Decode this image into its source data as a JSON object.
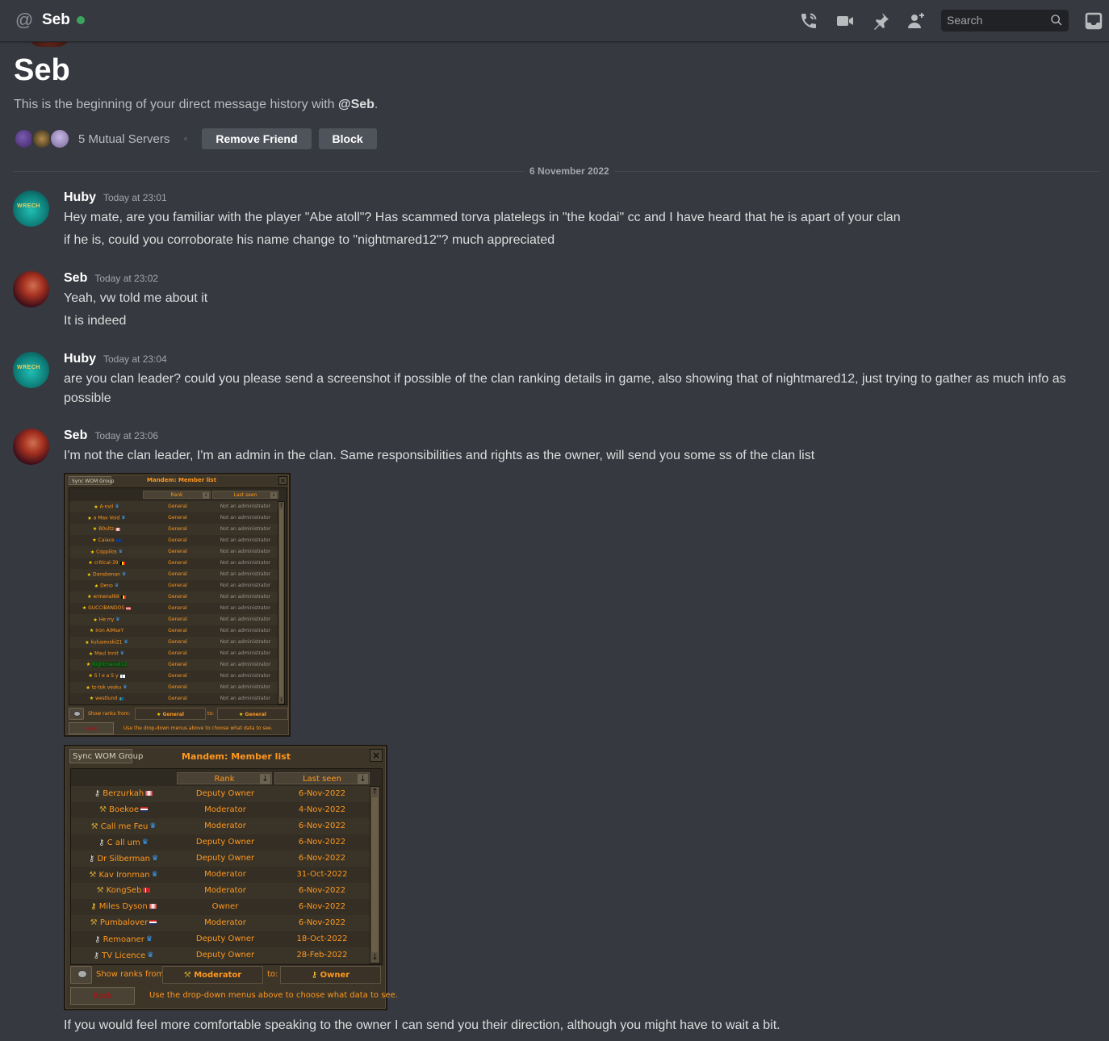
{
  "header": {
    "channel_name": "Seb",
    "status": "online",
    "status_color": "#3ba55d",
    "icons": [
      "start-voice-call-icon",
      "start-video-call-icon",
      "pinned-messages-icon",
      "add-friends-to-dm-icon"
    ],
    "search_placeholder": "Search",
    "inbox_icon": "inbox-icon"
  },
  "intro": {
    "name": "Seb",
    "subtitle_prefix": "This is the beginning of your direct message history with ",
    "subtitle_mention": "@Seb",
    "subtitle_suffix": ".",
    "mutual_servers": "5 Mutual Servers",
    "remove_friend": "Remove Friend",
    "block": "Block"
  },
  "date_divider": "6 November 2022",
  "messages": [
    {
      "author": "Huby",
      "time": "Today at 23:01",
      "lines": [
        "Hey mate, are you familiar with the player \"Abe atoll\"? Has scammed torva platelegs in \"the kodai\" cc and I have heard that he is apart of your clan",
        "if he is, could you corroborate his name change to \"nightmared12\"? much appreciated"
      ]
    },
    {
      "author": "Seb",
      "time": "Today at 23:02",
      "lines": [
        "Yeah, vw told me about it",
        "It is indeed"
      ]
    },
    {
      "author": "Huby",
      "time": "Today at 23:04",
      "lines": [
        "are you clan leader? could you please send a screenshot if possible of the clan ranking details in game, also showing that of nightmared12, just trying to gather as much info as possible"
      ]
    },
    {
      "author": "Seb",
      "time": "Today at 23:06",
      "lines": [
        "I'm not the clan leader, I'm an admin in the clan. Same responsibilities and rights as the owner, will send you some ss of the clan list",
        "If you would feel more comfortable speaking to the owner I can send you their direction, although you might have to wait a bit."
      ]
    }
  ],
  "attachments": [
    {
      "sync_button": "Sync WOM Group",
      "title": "Mandem: Member list",
      "col_rank": "Rank",
      "col_last_seen": "Last seen",
      "rows": [
        {
          "icon": "star",
          "name": "A-nvil",
          "flag": "crown",
          "rank": "General",
          "seen": "Not an administrator"
        },
        {
          "icon": "star",
          "name": "a Max Void",
          "flag": "crown",
          "rank": "General",
          "seen": "Not an administrator"
        },
        {
          "icon": "star",
          "name": "B0ultz",
          "flag": "uk",
          "rank": "General",
          "seen": "Not an administrator"
        },
        {
          "icon": "star",
          "name": "Caiace",
          "flag": "au",
          "rank": "General",
          "seen": "Not an administrator"
        },
        {
          "icon": "star",
          "name": "Coppilos",
          "flag": "crown",
          "rank": "General",
          "seen": "Not an administrator"
        },
        {
          "icon": "star",
          "name": "critical-39",
          "flag": "be",
          "rank": "General",
          "seen": "Not an administrator"
        },
        {
          "icon": "star",
          "name": "Dansbenan",
          "flag": "crown",
          "rank": "General",
          "seen": "Not an administrator"
        },
        {
          "icon": "star",
          "name": "Deno",
          "flag": "crown",
          "rank": "General",
          "seen": "Not an administrator"
        },
        {
          "icon": "star",
          "name": "ermenal69",
          "flag": "be",
          "rank": "General",
          "seen": "Not an administrator"
        },
        {
          "icon": "star",
          "name": "GUCCIBANDOS",
          "flag": "us",
          "rank": "General",
          "seen": "Not an administrator"
        },
        {
          "icon": "star",
          "name": "He rry",
          "flag": "crown",
          "rank": "General",
          "seen": "Not an administrator"
        },
        {
          "icon": "star",
          "name": "Iron AiMseY",
          "flag": "",
          "rank": "General",
          "seen": "Not an administrator"
        },
        {
          "icon": "star",
          "name": "kulusevski21",
          "flag": "crown",
          "rank": "General",
          "seen": "Not an administrator"
        },
        {
          "icon": "star",
          "name": "Maul Innit",
          "flag": "crown",
          "rank": "General",
          "seen": "Not an administrator"
        },
        {
          "icon": "star",
          "name": "Nightmared12",
          "flag": "",
          "rank": "General",
          "seen": "Not an administrator",
          "highlight": true
        },
        {
          "icon": "star",
          "name": "S l e a S y",
          "flag": "fi",
          "rank": "General",
          "seen": "Not an administrator"
        },
        {
          "icon": "star",
          "name": "tz-tok vesku",
          "flag": "crown",
          "rank": "General",
          "seen": "Not an administrator"
        },
        {
          "icon": "star",
          "name": "westlund",
          "flag": "se",
          "rank": "General",
          "seen": "Not an administrator"
        }
      ],
      "show_ranks_label": "Show ranks from:",
      "from_rank": "General",
      "to_label": "to:",
      "to_rank": "General",
      "from_icon": "star",
      "to_icon": "star",
      "back": "Back",
      "hint": "Use the drop-down menus above to choose what data to see."
    },
    {
      "sync_button": "Sync WOM Group",
      "title": "Mandem: Member list",
      "col_rank": "Rank",
      "col_last_seen": "Last seen",
      "rows": [
        {
          "icon": "key-silver",
          "name": "Berzurkah",
          "flag": "uk",
          "rank": "Deputy Owner",
          "seen": "6-Nov-2022"
        },
        {
          "icon": "hammer",
          "name": "Boekoe",
          "flag": "nl",
          "rank": "Moderator",
          "seen": "4-Nov-2022"
        },
        {
          "icon": "hammer",
          "name": "Call me Feu",
          "flag": "crown",
          "rank": "Moderator",
          "seen": "6-Nov-2022"
        },
        {
          "icon": "key-silver",
          "name": "C all um",
          "flag": "crown",
          "rank": "Deputy Owner",
          "seen": "6-Nov-2022"
        },
        {
          "icon": "key-silver",
          "name": "Dr Silberman",
          "flag": "crown",
          "rank": "Deputy Owner",
          "seen": "6-Nov-2022"
        },
        {
          "icon": "hammer",
          "name": "Kav Ironman",
          "flag": "crown",
          "rank": "Moderator",
          "seen": "31-Oct-2022"
        },
        {
          "icon": "hammer",
          "name": "KongSeb",
          "flag": "dk",
          "rank": "Moderator",
          "seen": "6-Nov-2022"
        },
        {
          "icon": "key-gold",
          "name": "Miles Dyson",
          "flag": "uk",
          "rank": "Owner",
          "seen": "6-Nov-2022"
        },
        {
          "icon": "hammer",
          "name": "Pumbalover",
          "flag": "nl",
          "rank": "Moderator",
          "seen": "6-Nov-2022"
        },
        {
          "icon": "key-silver",
          "name": "Remoaner",
          "flag": "crown",
          "rank": "Deputy Owner",
          "seen": "18-Oct-2022"
        },
        {
          "icon": "key-silver",
          "name": "TV Licence",
          "flag": "crown",
          "rank": "Deputy Owner",
          "seen": "28-Feb-2022"
        }
      ],
      "show_ranks_label": "Show ranks from:",
      "from_rank": "Moderator",
      "to_label": "to:",
      "to_rank": "Owner",
      "from_icon": "hammer",
      "to_icon": "key-gold",
      "back": "Back",
      "hint": "Use the drop-down menus above to choose what data to see."
    }
  ]
}
